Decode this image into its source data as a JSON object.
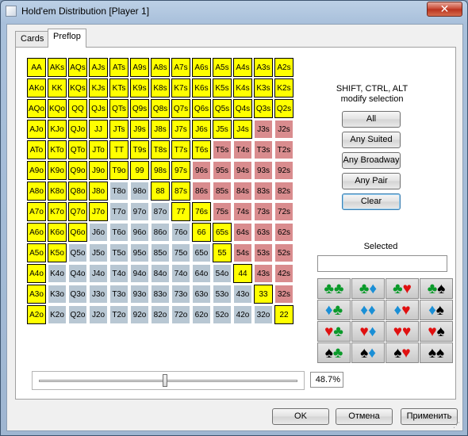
{
  "window": {
    "title": "Hold'em Distribution [Player 1]",
    "close_label": "✕"
  },
  "tabs": [
    {
      "label": "Cards"
    },
    {
      "label": "Preflop"
    }
  ],
  "hint": {
    "line1": "SHIFT, CTRL, ALT",
    "line2": "modify selection"
  },
  "buttons": {
    "all": "All",
    "any_suited": "Any Suited",
    "any_broadway": "Any Broadway",
    "any_pair": "Any Pair",
    "clear": "Clear"
  },
  "selected": {
    "label": "Selected",
    "value": ""
  },
  "range": {
    "percent_label": "48.7%",
    "slider_fraction": 0.487
  },
  "footer": {
    "ok": "OK",
    "cancel": "Отмена",
    "apply": "Применить"
  },
  "colors": {
    "selected": "#ffff00",
    "suited_unselected": "#d98c8e",
    "offsuit_unselected": "#b8c7d3"
  },
  "hand_matrix": [
    [
      "AA",
      "AKs",
      "AQs",
      "AJs",
      "ATs",
      "A9s",
      "A8s",
      "A7s",
      "A6s",
      "A5s",
      "A4s",
      "A3s",
      "A2s"
    ],
    [
      "AKo",
      "KK",
      "KQs",
      "KJs",
      "KTs",
      "K9s",
      "K8s",
      "K7s",
      "K6s",
      "K5s",
      "K4s",
      "K3s",
      "K2s"
    ],
    [
      "AQo",
      "KQo",
      "QQ",
      "QJs",
      "QTs",
      "Q9s",
      "Q8s",
      "Q7s",
      "Q6s",
      "Q5s",
      "Q4s",
      "Q3s",
      "Q2s"
    ],
    [
      "AJo",
      "KJo",
      "QJo",
      "JJ",
      "JTs",
      "J9s",
      "J8s",
      "J7s",
      "J6s",
      "J5s",
      "J4s",
      "J3s",
      "J2s"
    ],
    [
      "ATo",
      "KTo",
      "QTo",
      "JTo",
      "TT",
      "T9s",
      "T8s",
      "T7s",
      "T6s",
      "T5s",
      "T4s",
      "T3s",
      "T2s"
    ],
    [
      "A9o",
      "K9o",
      "Q9o",
      "J9o",
      "T9o",
      "99",
      "98s",
      "97s",
      "96s",
      "95s",
      "94s",
      "93s",
      "92s"
    ],
    [
      "A8o",
      "K8o",
      "Q8o",
      "J8o",
      "T8o",
      "98o",
      "88",
      "87s",
      "86s",
      "85s",
      "84s",
      "83s",
      "82s"
    ],
    [
      "A7o",
      "K7o",
      "Q7o",
      "J7o",
      "T7o",
      "97o",
      "87o",
      "77",
      "76s",
      "75s",
      "74s",
      "73s",
      "72s"
    ],
    [
      "A6o",
      "K6o",
      "Q6o",
      "J6o",
      "T6o",
      "96o",
      "86o",
      "76o",
      "66",
      "65s",
      "64s",
      "63s",
      "62s"
    ],
    [
      "A5o",
      "K5o",
      "Q5o",
      "J5o",
      "T5o",
      "95o",
      "85o",
      "75o",
      "65o",
      "55",
      "54s",
      "53s",
      "52s"
    ],
    [
      "A4o",
      "K4o",
      "Q4o",
      "J4o",
      "T4o",
      "94o",
      "84o",
      "74o",
      "64o",
      "54o",
      "44",
      "43s",
      "42s"
    ],
    [
      "A3o",
      "K3o",
      "Q3o",
      "J3o",
      "T3o",
      "93o",
      "83o",
      "73o",
      "63o",
      "53o",
      "43o",
      "33",
      "32s"
    ],
    [
      "A2o",
      "K2o",
      "Q2o",
      "J2o",
      "T2o",
      "92o",
      "82o",
      "72o",
      "62o",
      "52o",
      "42o",
      "32o",
      "22"
    ]
  ],
  "selected_hands": [
    "AA",
    "AKs",
    "AQs",
    "AJs",
    "ATs",
    "A9s",
    "A8s",
    "A7s",
    "A6s",
    "A5s",
    "A4s",
    "A3s",
    "A2s",
    "AKo",
    "KK",
    "KQs",
    "KJs",
    "KTs",
    "K9s",
    "K8s",
    "K7s",
    "K6s",
    "K5s",
    "K4s",
    "K3s",
    "K2s",
    "AQo",
    "KQo",
    "QQ",
    "QJs",
    "QTs",
    "Q9s",
    "Q8s",
    "Q7s",
    "Q6s",
    "Q5s",
    "Q4s",
    "Q3s",
    "Q2s",
    "AJo",
    "KJo",
    "QJo",
    "JJ",
    "JTs",
    "J9s",
    "J8s",
    "J7s",
    "J6s",
    "J5s",
    "J4s",
    "ATo",
    "KTo",
    "QTo",
    "JTo",
    "TT",
    "T9s",
    "T8s",
    "T7s",
    "T6s",
    "A9o",
    "K9o",
    "Q9o",
    "J9o",
    "T9o",
    "99",
    "98s",
    "97s",
    "A8o",
    "K8o",
    "Q8o",
    "J8o",
    "88",
    "87s",
    "A7o",
    "K7o",
    "Q7o",
    "J7o",
    "77",
    "76s",
    "A6o",
    "K6o",
    "Q6o",
    "66",
    "65s",
    "A5o",
    "K5o",
    "55",
    "A4o",
    "44",
    "A3o",
    "33",
    "A2o",
    "22"
  ],
  "suit_combos": [
    [
      {
        "c1": "♣",
        "k1": "green",
        "c2": "♣",
        "k2": "green"
      },
      {
        "c1": "♣",
        "k1": "green",
        "c2": "♦",
        "k2": "blue"
      },
      {
        "c1": "♣",
        "k1": "green",
        "c2": "♥",
        "k2": "red"
      },
      {
        "c1": "♣",
        "k1": "green",
        "c2": "♠",
        "k2": "black"
      }
    ],
    [
      {
        "c1": "♦",
        "k1": "blue",
        "c2": "♣",
        "k2": "green"
      },
      {
        "c1": "♦",
        "k1": "blue",
        "c2": "♦",
        "k2": "blue"
      },
      {
        "c1": "♦",
        "k1": "blue",
        "c2": "♥",
        "k2": "red"
      },
      {
        "c1": "♦",
        "k1": "blue",
        "c2": "♠",
        "k2": "black"
      }
    ],
    [
      {
        "c1": "♥",
        "k1": "red",
        "c2": "♣",
        "k2": "green"
      },
      {
        "c1": "♥",
        "k1": "red",
        "c2": "♦",
        "k2": "blue"
      },
      {
        "c1": "♥",
        "k1": "red",
        "c2": "♥",
        "k2": "red"
      },
      {
        "c1": "♥",
        "k1": "red",
        "c2": "♠",
        "k2": "black"
      }
    ],
    [
      {
        "c1": "♠",
        "k1": "black",
        "c2": "♣",
        "k2": "green"
      },
      {
        "c1": "♠",
        "k1": "black",
        "c2": "♦",
        "k2": "blue"
      },
      {
        "c1": "♠",
        "k1": "black",
        "c2": "♥",
        "k2": "red"
      },
      {
        "c1": "♠",
        "k1": "black",
        "c2": "♠",
        "k2": "black"
      }
    ]
  ],
  "suit_colors": {
    "green": "#0a9a2a",
    "blue": "#1a8fd6",
    "red": "#e01010",
    "black": "#000000"
  }
}
